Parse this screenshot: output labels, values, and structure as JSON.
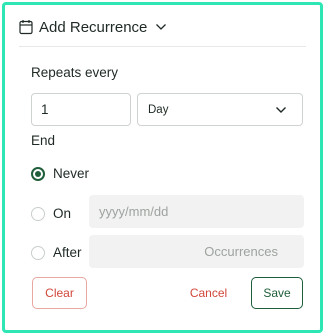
{
  "header": {
    "title": "Add Recurrence",
    "calendar_icon": "calendar-icon",
    "chevron_icon": "chevron-down-icon"
  },
  "repeats": {
    "label": "Repeats every",
    "interval_value": "1",
    "unit_selected": "Day"
  },
  "end": {
    "label": "End",
    "selected": "never",
    "options": [
      {
        "id": "never",
        "label": "Never"
      },
      {
        "id": "on",
        "label": "On",
        "placeholder": "yyyy/mm/dd"
      },
      {
        "id": "after",
        "label": "After",
        "placeholder": "Occurrences"
      }
    ]
  },
  "actions": {
    "clear": "Clear",
    "cancel": "Cancel",
    "save": "Save"
  },
  "colors": {
    "frame_border": "#2ee6b3",
    "primary_green": "#1f5e3a",
    "danger_red": "#d1473a"
  }
}
